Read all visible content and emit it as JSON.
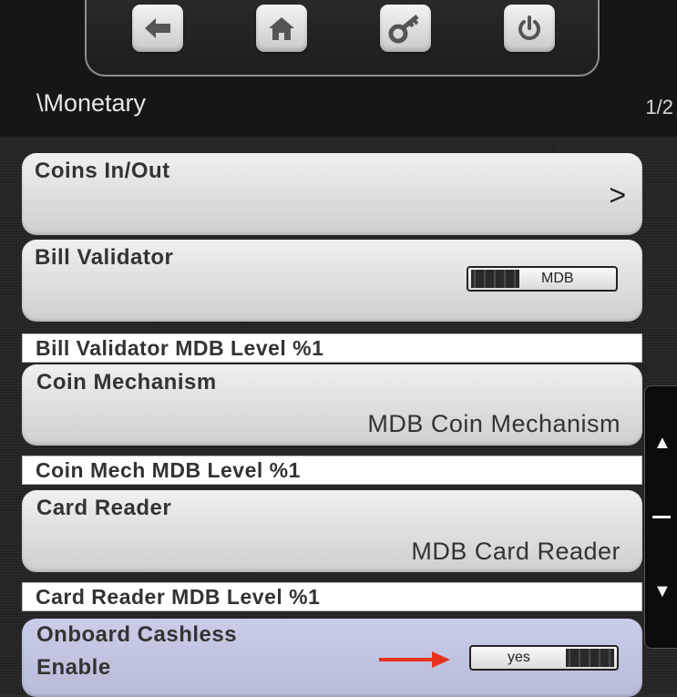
{
  "header": {
    "breadcrumb": "\\Monetary",
    "page_indicator": "1/2",
    "nav_buttons": [
      {
        "icon": "back-arrow-icon"
      },
      {
        "icon": "home-icon"
      },
      {
        "icon": "key-icon"
      },
      {
        "icon": "power-icon"
      }
    ]
  },
  "items": {
    "coins_in_out": {
      "label": "Coins In/Out",
      "chevron": ">"
    },
    "bill_validator": {
      "label": "Bill Validator",
      "toggle_value": "MDB"
    },
    "bill_validator_level": {
      "label": "Bill Validator MDB Level %1"
    },
    "coin_mechanism": {
      "label": "Coin Mechanism",
      "value": "MDB Coin Mechanism"
    },
    "coin_mech_level": {
      "label": "Coin Mech MDB Level %1"
    },
    "card_reader": {
      "label": "Card Reader",
      "value": "MDB Card Reader"
    },
    "card_reader_level": {
      "label": "Card Reader MDB Level %1"
    },
    "onboard_cashless": {
      "label_line1": "Onboard Cashless",
      "label_line2": "Enable",
      "toggle_value": "yes"
    }
  },
  "colors": {
    "annotation_arrow": "#e8331c",
    "highlight_row": "#c0c3e0"
  }
}
